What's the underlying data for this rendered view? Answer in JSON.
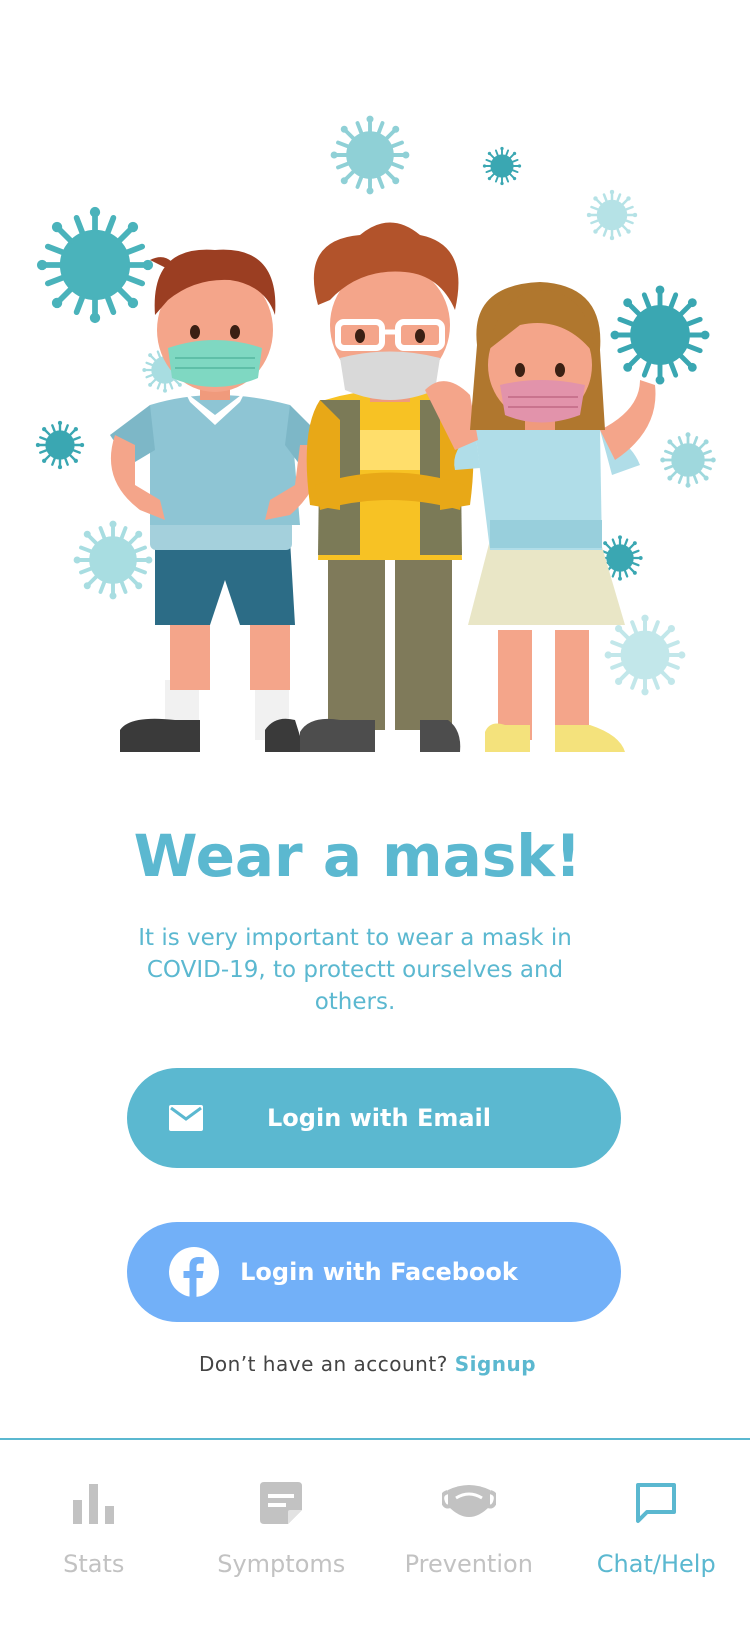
{
  "main": {
    "title": "Wear a mask!",
    "description": "It is very important to wear a mask in COVID-19, to protectt ourselves and others."
  },
  "buttons": {
    "email_label": "Login with Email",
    "facebook_label": "Login with Facebook"
  },
  "signup": {
    "prompt": "Don’t have an account?",
    "link": "Signup"
  },
  "nav": {
    "items": [
      {
        "label": "Stats",
        "icon": "bar-chart-icon",
        "active": false
      },
      {
        "label": "Symptoms",
        "icon": "note-icon",
        "active": false
      },
      {
        "label": "Prevention",
        "icon": "mask-icon",
        "active": false
      },
      {
        "label": "Chat/Help",
        "icon": "chat-bubble-icon",
        "active": true
      }
    ]
  },
  "colors": {
    "accent": "#5bb8d0",
    "facebook": "#72b0f8",
    "inactive": "#c2c2c2"
  }
}
